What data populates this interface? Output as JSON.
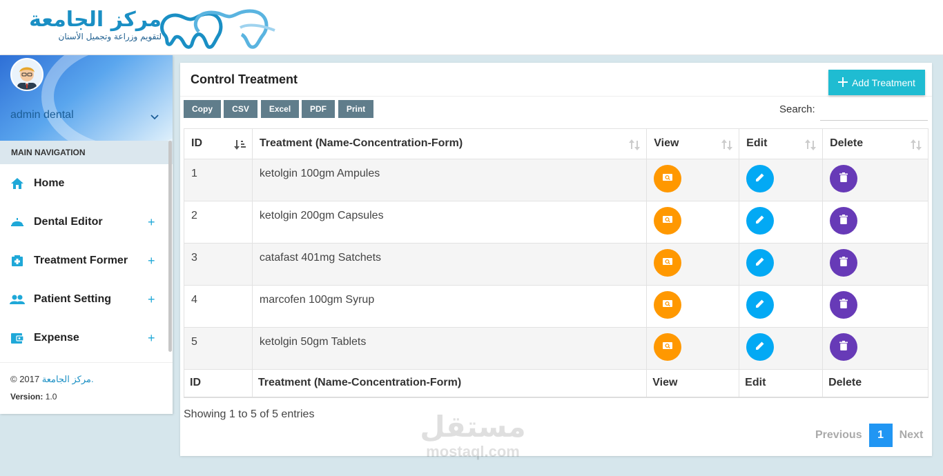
{
  "header": {
    "logo_title": "مركز الجامعة",
    "logo_subtitle": "لتقويم وزراعة وتجميل الأسنان"
  },
  "sidebar": {
    "user_name": "admin dental",
    "nav_header": "MAIN NAVIGATION",
    "items": [
      {
        "label": "Home",
        "icon": "home-icon",
        "expandable": false
      },
      {
        "label": "Dental Editor",
        "icon": "dental-icon",
        "expandable": true
      },
      {
        "label": "Treatment Former",
        "icon": "medical-icon",
        "expandable": true
      },
      {
        "label": "Patient Setting",
        "icon": "people-icon",
        "expandable": true
      },
      {
        "label": "Expense",
        "icon": "wallet-icon",
        "expandable": true
      }
    ],
    "expand_symbol": "+",
    "footer_copyright": "© 2017",
    "footer_link": "مركز الجامعة.",
    "version_label": "Version:",
    "version_value": "1.0"
  },
  "panel": {
    "title": "Control Treatment",
    "add_button": "Add Treatment",
    "export_buttons": [
      "Copy",
      "CSV",
      "Excel",
      "PDF",
      "Print"
    ],
    "search_label": "Search:",
    "search_value": "",
    "columns": [
      "ID",
      "Treatment (Name-Concentration-Form)",
      "View",
      "Edit",
      "Delete"
    ],
    "rows": [
      {
        "id": "1",
        "treatment": "ketolgin 100gm Ampules"
      },
      {
        "id": "2",
        "treatment": "ketolgin 200gm Capsules"
      },
      {
        "id": "3",
        "treatment": "catafast 401mg Satchets"
      },
      {
        "id": "4",
        "treatment": "marcofen 100gm Syrup"
      },
      {
        "id": "5",
        "treatment": "ketolgin 50gm Tablets"
      }
    ],
    "info": "Showing 1 to 5 of 5 entries",
    "pager": {
      "previous": "Previous",
      "current": "1",
      "next": "Next"
    }
  },
  "watermark": {
    "arabic": "مستقل",
    "latin": "mostaql.com"
  },
  "colors": {
    "accent": "#1fbcd2",
    "view": "#ff9800",
    "edit": "#03a9f4",
    "delete": "#673ab7",
    "export": "#607d8b",
    "pager": "#2196f3"
  }
}
